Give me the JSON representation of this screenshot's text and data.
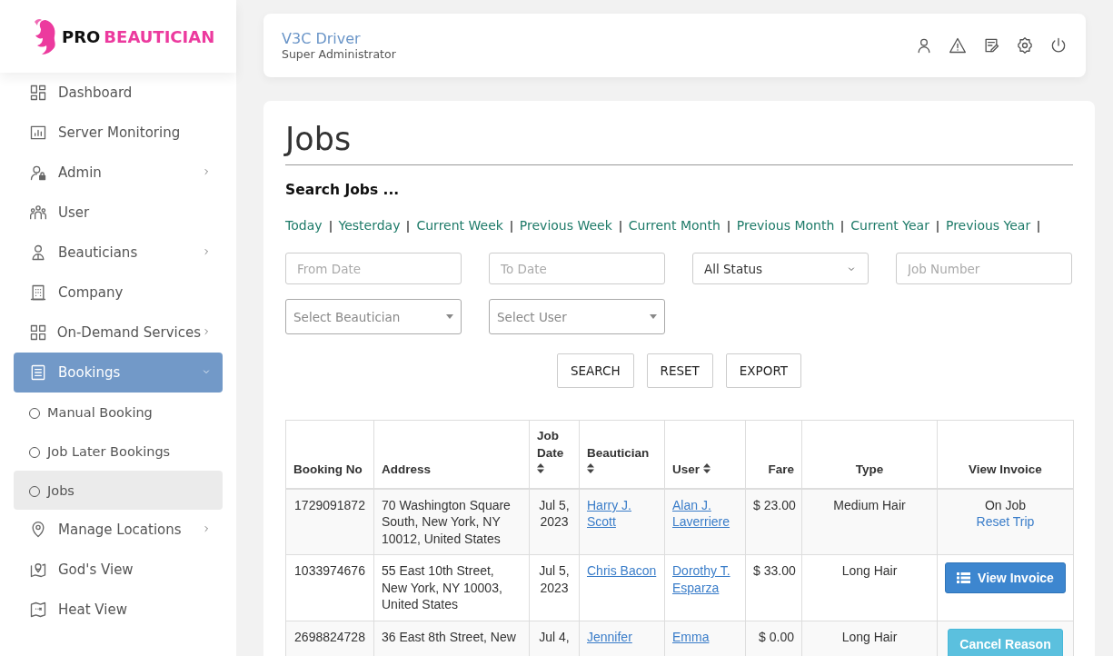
{
  "brand": {
    "first": "PRO",
    "second": "BEAUTICIAN"
  },
  "sidebar": {
    "items": [
      {
        "label": "Dashboard",
        "has_submenu": false,
        "selected": false
      },
      {
        "label": "Server Monitoring",
        "has_submenu": false,
        "selected": false
      },
      {
        "label": "Admin",
        "has_submenu": true,
        "expanded": false,
        "selected": false
      },
      {
        "label": "User",
        "has_submenu": false,
        "selected": false
      },
      {
        "label": "Beauticians",
        "has_submenu": true,
        "expanded": false,
        "selected": false
      },
      {
        "label": "Company",
        "has_submenu": false,
        "selected": false
      },
      {
        "label": "On-Demand Services",
        "has_submenu": true,
        "expanded": false,
        "selected": false
      },
      {
        "label": "Bookings",
        "has_submenu": true,
        "expanded": true,
        "selected": true,
        "children": [
          {
            "label": "Manual Booking",
            "selected": false
          },
          {
            "label": "Job Later Bookings",
            "selected": false
          },
          {
            "label": "Jobs",
            "selected": true
          }
        ]
      },
      {
        "label": "Manage Locations",
        "has_submenu": true,
        "expanded": false,
        "selected": false
      },
      {
        "label": "God's View",
        "has_submenu": false,
        "selected": false
      },
      {
        "label": "Heat View",
        "has_submenu": false,
        "selected": false
      }
    ]
  },
  "header": {
    "name": "V3C Driver",
    "role": "Super Administrator"
  },
  "page": {
    "title": "Jobs",
    "search_title": "Search Jobs ...",
    "quick_filters": [
      "Today",
      "Yesterday",
      "Current Week",
      "Previous Week",
      "Current Month",
      "Previous Month",
      "Current Year",
      "Previous Year"
    ],
    "filters": [
      {
        "kind": "text",
        "placeholder": "From Date"
      },
      {
        "kind": "text",
        "placeholder": "To Date"
      },
      {
        "kind": "select",
        "value": "All Status"
      },
      {
        "kind": "text",
        "placeholder": "Job Number"
      },
      {
        "kind": "combo",
        "placeholder": "Select Beautician"
      },
      {
        "kind": "combo",
        "placeholder": "Select User"
      }
    ],
    "buttons": [
      "SEARCH",
      "RESET",
      "EXPORT"
    ]
  },
  "table": {
    "columns": [
      {
        "label": "Booking No",
        "sortable": false
      },
      {
        "label": "Address",
        "sortable": false
      },
      {
        "label": "Job Date",
        "sortable": true
      },
      {
        "label": "Beautician",
        "sortable": true
      },
      {
        "label": "User",
        "sortable": true
      },
      {
        "label": "Fare",
        "sortable": false
      },
      {
        "label": "Type",
        "sortable": false
      },
      {
        "label": "View Invoice",
        "sortable": false
      }
    ],
    "rows": [
      {
        "booking_no": "1729091872",
        "address": "70 Washington Square South, New York, NY 10012, United States",
        "job_date": "Jul 5, 2023",
        "beautician": "Harry J. Scott",
        "user": "Alan J. Laverriere",
        "fare": "$ 23.00",
        "type": "Medium Hair",
        "invoice": {
          "kind": "status",
          "status": "On Job",
          "link": "Reset Trip"
        }
      },
      {
        "booking_no": "1033974676",
        "address": "55 East 10th Street, New York, NY 10003, United States",
        "job_date": "Jul 5, 2023",
        "beautician": "Chris Bacon",
        "user": "Dorothy T. Esparza",
        "fare": "$ 33.00",
        "type": "Long Hair",
        "invoice": {
          "kind": "invoice",
          "label": "View Invoice"
        }
      },
      {
        "booking_no": "2698824728",
        "address": "36 East 8th Street, New",
        "job_date": "Jul 4,",
        "beautician": "Jennifer",
        "user": "Emma",
        "fare": "$ 0.00",
        "type": "Long Hair",
        "invoice": {
          "kind": "cancel",
          "label": "Cancel Reason"
        }
      }
    ]
  }
}
